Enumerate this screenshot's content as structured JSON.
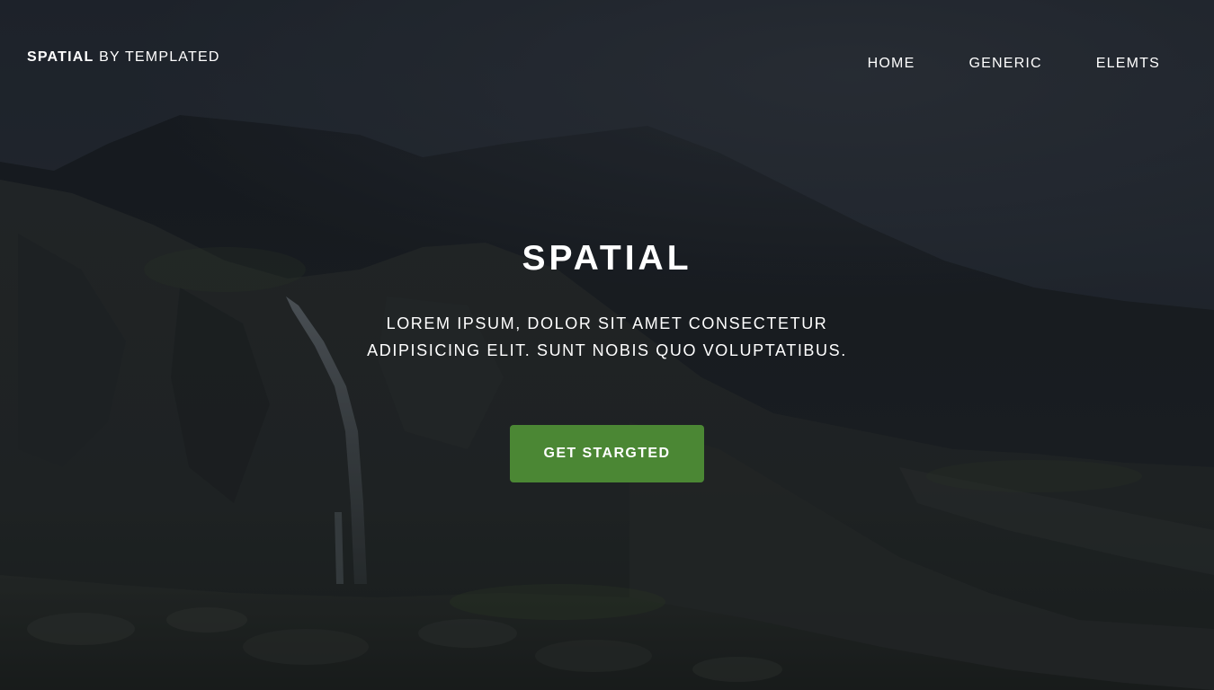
{
  "header": {
    "logo_brand": "SPATIAL",
    "logo_suffix": "BY TEMPLATED",
    "nav": [
      {
        "label": "HOME"
      },
      {
        "label": "GENERIC"
      },
      {
        "label": "ELEMTS"
      }
    ]
  },
  "hero": {
    "title": "SPATIAL",
    "text": "LOREM IPSUM, DOLOR SIT AMET CONSECTETUR ADIPISICING ELIT. SUNT NOBIS QUO VOLUPTATIBUS.",
    "button_label": "GET STARGTED"
  },
  "colors": {
    "accent": "#4b8734",
    "overlay_dark": "#151a1f",
    "text": "#ffffff"
  }
}
